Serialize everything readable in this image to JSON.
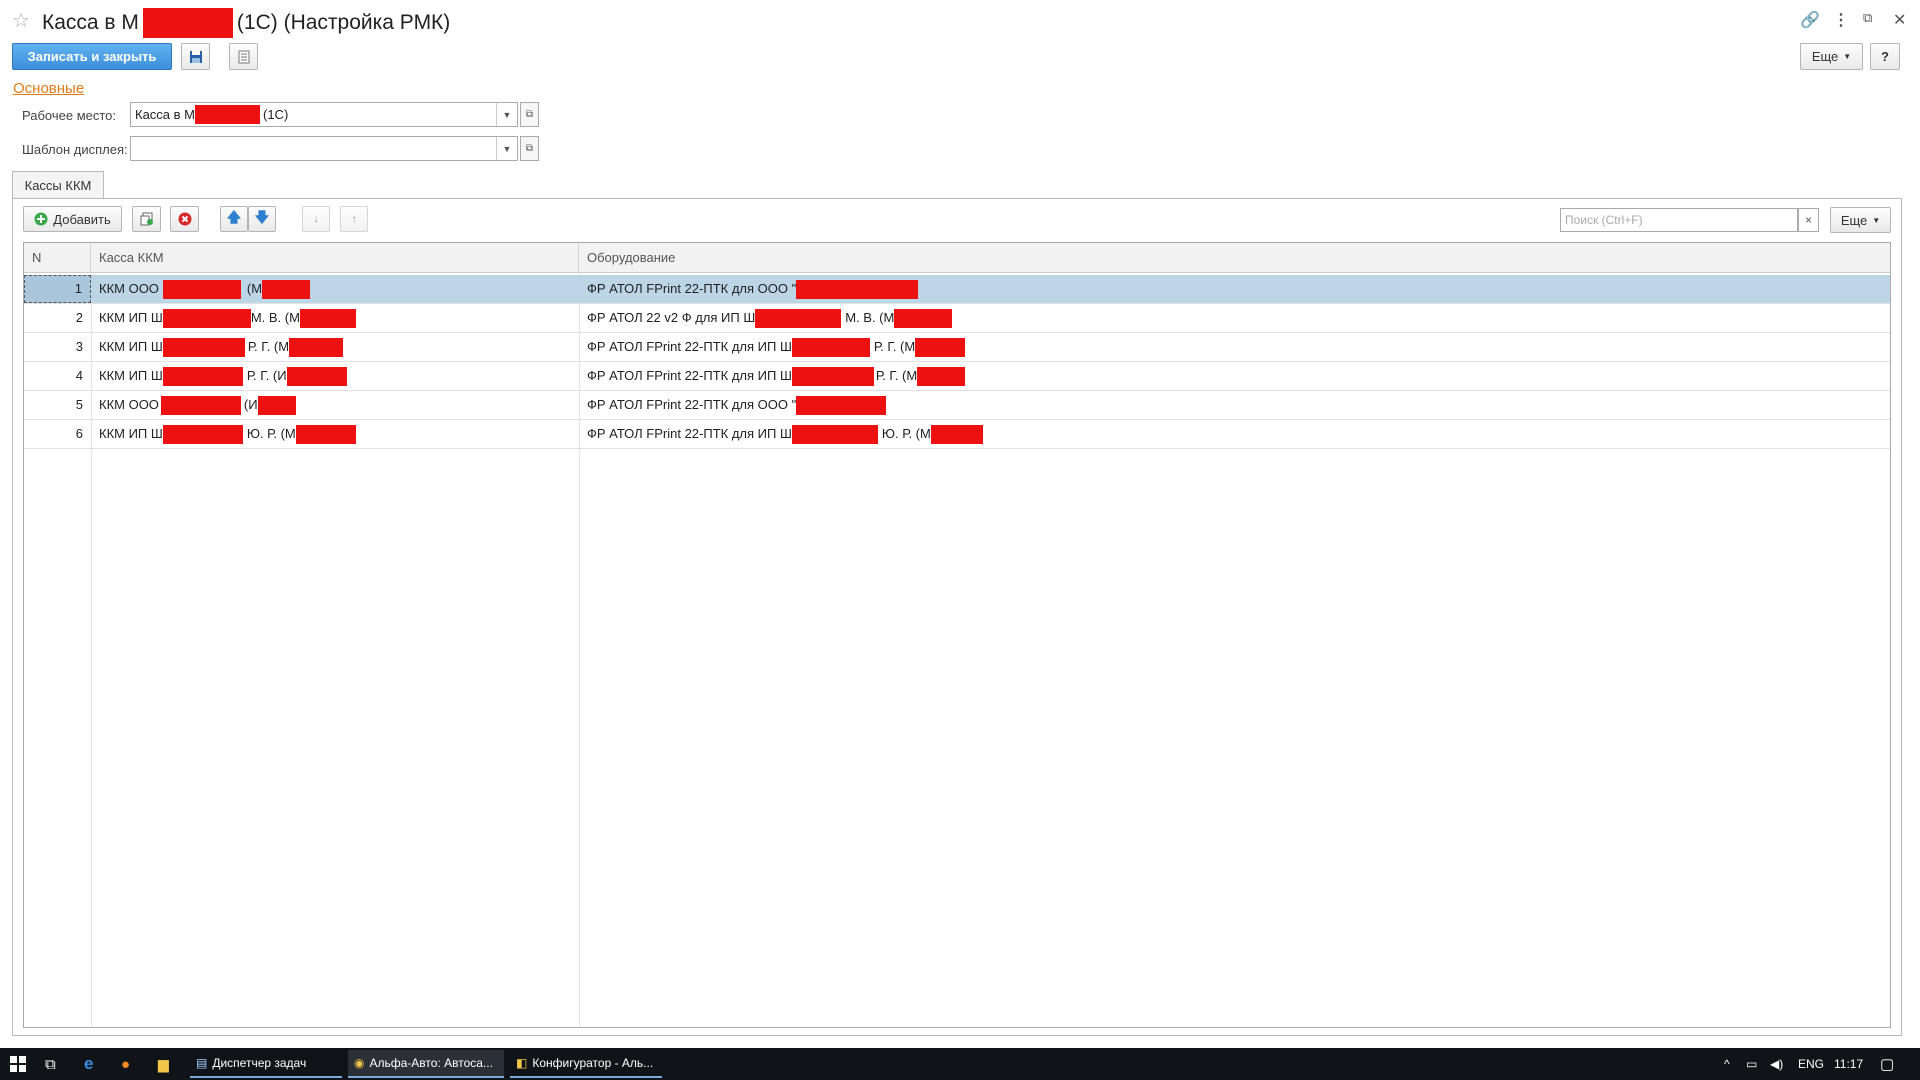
{
  "window": {
    "title_prefix": "Касса в М",
    "title_suffix": "(1С) (Настройка РМК)",
    "icons": [
      "star-icon",
      "link-icon",
      "menu-dots-icon",
      "restore-icon",
      "close-icon"
    ]
  },
  "toolbar": {
    "save_close_label": "Записать и закрыть",
    "more_label": "Еще",
    "help_label": "?"
  },
  "group_link": "Основные",
  "fields": {
    "workplace_label": "Рабочее место:",
    "workplace_value_prefix": "Касса в М",
    "workplace_value_suffix": "(1С)",
    "display_template_label": "Шаблон дисплея:",
    "display_template_value": ""
  },
  "tab": {
    "label": "Кассы ККМ"
  },
  "table_toolbar": {
    "add_label": "Добавить",
    "search_placeholder": "Поиск (Ctrl+F)",
    "search_clear": "×",
    "more_label": "Еще"
  },
  "table": {
    "columns": [
      "N",
      "Касса ККМ",
      "Оборудование"
    ],
    "rows": [
      {
        "n": "1",
        "kassa_a": "ККМ ООО",
        "kassa_b": "(М",
        "kassa_c": "",
        "equip_a": "ФР АТОЛ FPrint 22-ПТК для ООО \"",
        "equip_b": "",
        "selected": true
      },
      {
        "n": "2",
        "kassa_a": "ККМ ИП Ш",
        "kassa_b": "М. В. (М",
        "kassa_c": "",
        "equip_a": "ФР АТОЛ 22 v2 Ф для ИП Ш",
        "equip_b": "М. В. (М",
        "selected": false
      },
      {
        "n": "3",
        "kassa_a": "ККМ ИП Ш",
        "kassa_b": "Р. Г. (М",
        "kassa_c": "",
        "equip_a": "ФР АТОЛ FPrint 22-ПТК для ИП Ш",
        "equip_b": "Р. Г. (М",
        "selected": false
      },
      {
        "n": "4",
        "kassa_a": "ККМ ИП Ш",
        "kassa_b": "Р. Г. (И",
        "kassa_c": "",
        "equip_a": "ФР АТОЛ FPrint 22-ПТК для ИП Ш",
        "equip_b": "Р. Г. (М",
        "selected": false
      },
      {
        "n": "5",
        "kassa_a": "ККМ ООО",
        "kassa_b": "(И",
        "kassa_c": "",
        "equip_a": "ФР АТОЛ FPrint 22-ПТК для ООО \"",
        "equip_b": "",
        "selected": false
      },
      {
        "n": "6",
        "kassa_a": "ККМ ИП Ш",
        "kassa_b": "Ю. Р. (М",
        "kassa_c": "",
        "equip_a": "ФР АТОЛ FPrint 22-ПТК для ИП Ш",
        "equip_b": "Ю. Р. (М",
        "selected": false
      }
    ]
  },
  "taskbar": {
    "apps": [
      "Диспетчер задач",
      "Альфа-Авто: Автоса...",
      "Конфигуратор - Аль..."
    ],
    "lang": "ENG",
    "time": "11:17"
  }
}
